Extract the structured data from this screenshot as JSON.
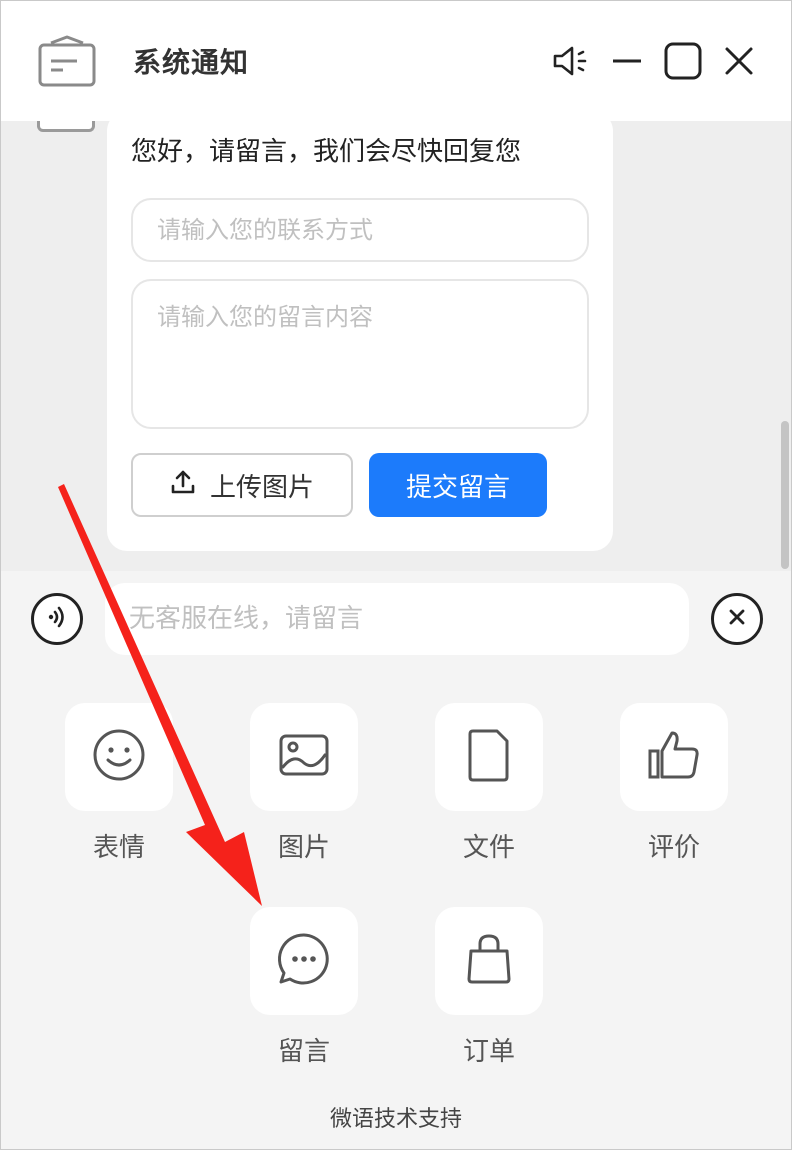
{
  "header": {
    "title": "系统通知",
    "icons": [
      "inbox-icon",
      "speaker-mute-icon",
      "minimize-icon",
      "maximize-icon",
      "close-icon"
    ]
  },
  "message_form": {
    "prompt": "您好，请留言，我们会尽快回复您",
    "contact_placeholder": "请输入您的联系方式",
    "message_placeholder": "请输入您的留言内容",
    "upload_label": "上传图片",
    "submit_label": "提交留言"
  },
  "input_bar": {
    "placeholder": "无客服在线，请留言"
  },
  "tools": [
    {
      "label": "表情",
      "icon": "smile-icon"
    },
    {
      "label": "图片",
      "icon": "image-icon"
    },
    {
      "label": "文件",
      "icon": "file-icon"
    },
    {
      "label": "评价",
      "icon": "thumbs-up-icon"
    },
    {
      "label": "留言",
      "icon": "chat-bubble-icon"
    },
    {
      "label": "订单",
      "icon": "shopping-bag-icon"
    }
  ],
  "footer": {
    "text": "微语技术支持"
  },
  "colors": {
    "accent": "#1c7bfb",
    "annotation_arrow": "#f5221b",
    "panel_bg": "#f4f4f4"
  }
}
